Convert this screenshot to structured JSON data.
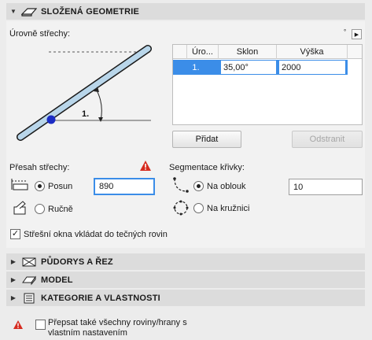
{
  "section_main": {
    "title": "SLOŽENÁ GEOMETRIE"
  },
  "roof_levels": {
    "label": "Úrovně střechy:",
    "diagram_level_label": "1.",
    "table": {
      "columns": [
        "Úro...",
        "Sklon",
        "Výška"
      ],
      "rows": [
        {
          "level": "1.",
          "slope": "35,00°",
          "height": "2000"
        }
      ]
    },
    "add_button": "Přidat",
    "remove_button": "Odstranit"
  },
  "overhang": {
    "label": "Přesah střechy:",
    "option_offset": "Posun",
    "option_manual": "Ručně",
    "value": "890"
  },
  "curve_segmentation": {
    "label": "Segmentace křivky:",
    "option_arc": "Na oblouk",
    "option_circle": "Na kružnici",
    "value": "10"
  },
  "skylights": {
    "label": "Střešní okna vkládat do tečných rovin",
    "checked": true
  },
  "sections": [
    {
      "title": "PŮDORYS A ŘEZ"
    },
    {
      "title": "MODEL"
    },
    {
      "title": "KATEGORIE A VLASTNOSTI"
    }
  ],
  "footer": {
    "override_line1": "Přepsat také všechny roviny/hrany s",
    "override_line2": "vlastním nastavením"
  },
  "colors": {
    "accent": "#3b8de8",
    "roof_fill": "#b9d6ea",
    "warning": "#d62b1f",
    "pivot": "#1b2cc4"
  }
}
